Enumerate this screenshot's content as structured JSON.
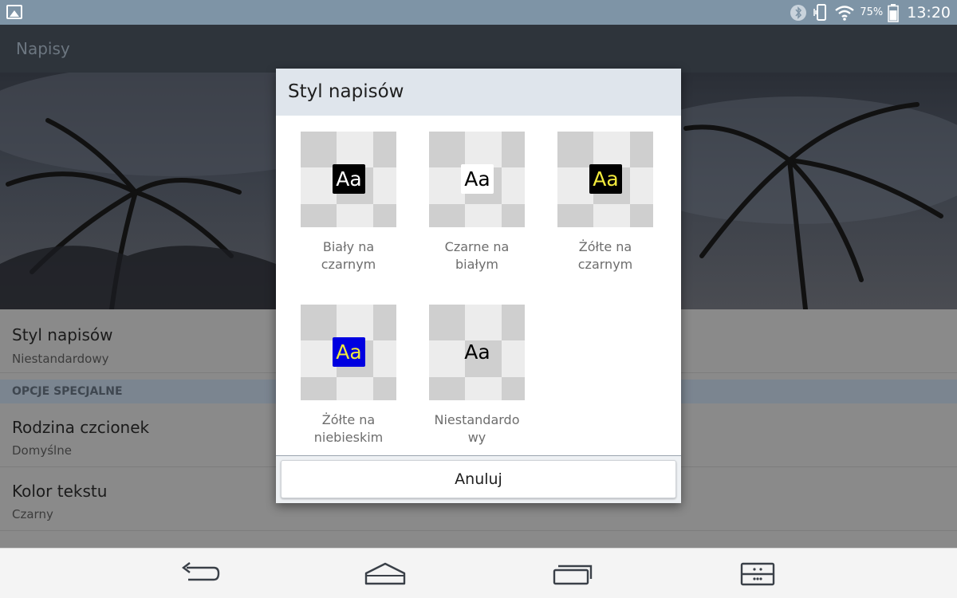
{
  "status_bar": {
    "battery_percent": "75%",
    "time": "13:20",
    "icons": [
      "gallery-icon",
      "bluetooth-icon",
      "vibrate-icon",
      "wifi-icon",
      "battery-icon"
    ],
    "battery_level": 0.75
  },
  "app": {
    "title": "Napisy",
    "settings": {
      "caption_style": {
        "title": "Styl napisów",
        "value": "Niestandardowy"
      },
      "section_header": "OPCJE SPECJALNE",
      "font_family": {
        "title": "Rodzina czcionek",
        "value": "Domyślne"
      },
      "text_color": {
        "title": "Kolor tekstu",
        "value": "Czarny"
      }
    }
  },
  "dialog": {
    "title": "Styl napisów",
    "sample_text": "Aa",
    "options": [
      {
        "label": "Biały na czarnym",
        "line1": "Biały na",
        "line2": "czarnym",
        "fg": "#ffffff",
        "bg": "#000000"
      },
      {
        "label": "Czarne na białym",
        "line1": "Czarne na",
        "line2": "białym",
        "fg": "#000000",
        "bg": "#ffffff"
      },
      {
        "label": "Żółte na czarnym",
        "line1": "Żółte na",
        "line2": "czarnym",
        "fg": "#f2ea3c",
        "bg": "#000000"
      },
      {
        "label": "Żółte na niebieskim",
        "line1": "Żółte na",
        "line2": "niebieskim",
        "fg": "#f2ea3c",
        "bg": "#0000e0"
      },
      {
        "label": "Niestandardowy",
        "line1": "Niestandardo",
        "line2": "wy",
        "fg": "#000000",
        "bg": "transparent"
      }
    ],
    "cancel_label": "Anuluj"
  },
  "nav_bar": {
    "icons": [
      "back-icon",
      "home-icon",
      "recent-apps-icon",
      "dual-window-icon"
    ]
  }
}
